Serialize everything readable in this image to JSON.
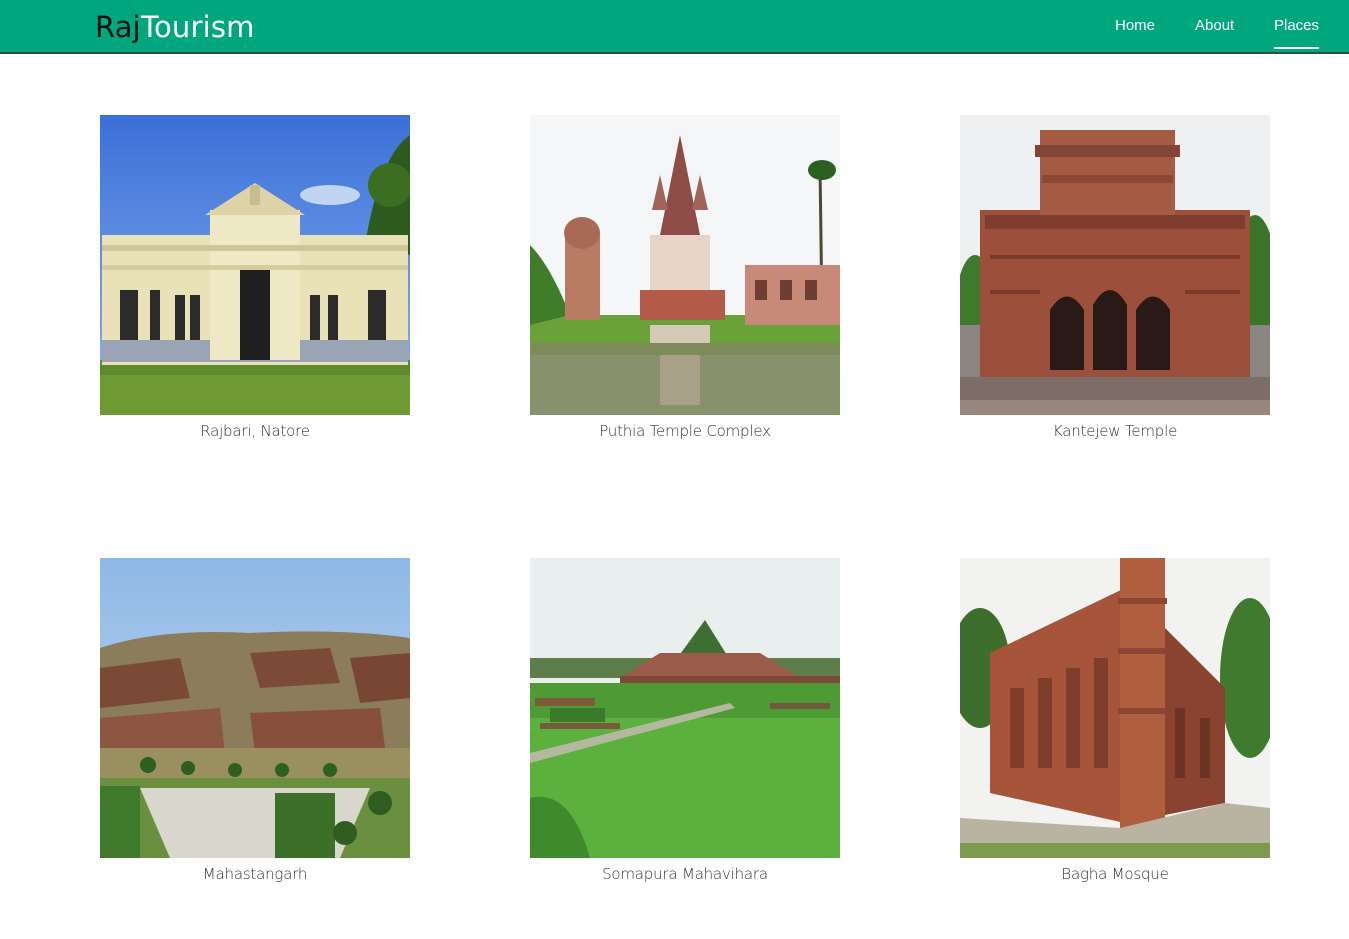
{
  "brand": {
    "part1": "Raj",
    "part2": "Tourism"
  },
  "nav": {
    "home": "Home",
    "about": "About",
    "places": "Places",
    "active": "Places"
  },
  "colors": {
    "navbar": "#00a67d",
    "navbar_border": "#2f4f45",
    "text": "#333333"
  },
  "places": [
    {
      "caption": "Rajbari, Natore",
      "photo": "palace-photo"
    },
    {
      "caption": "Puthia Temple Complex",
      "photo": "temple-pond-photo"
    },
    {
      "caption": "Kantejew Temple",
      "photo": "terracotta-temple-photo"
    },
    {
      "caption": "Mahastangarh",
      "photo": "ruins-photo"
    },
    {
      "caption": "Somapura Mahavihara",
      "photo": "vihara-photo"
    },
    {
      "caption": "Bagha Mosque",
      "photo": "mosque-photo"
    }
  ]
}
